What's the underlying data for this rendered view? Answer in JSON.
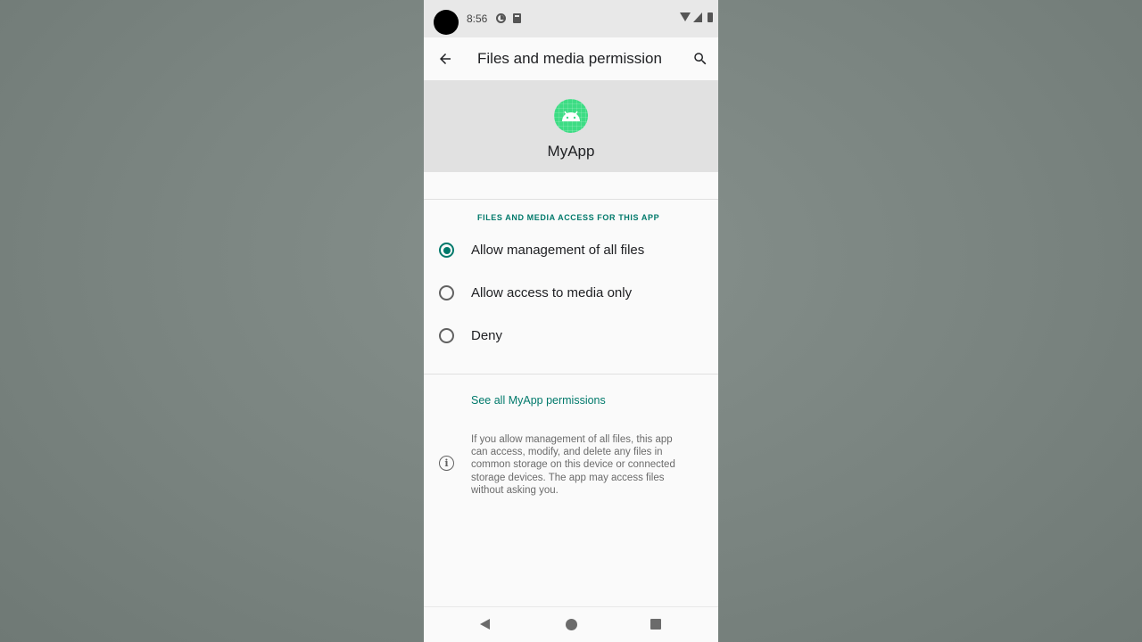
{
  "status_bar": {
    "time": "8:56"
  },
  "app_bar": {
    "title": "Files and media permission"
  },
  "app": {
    "name": "MyApp"
  },
  "section": {
    "header": "FILES AND MEDIA ACCESS FOR THIS APP"
  },
  "options": [
    {
      "label": "Allow management of all files",
      "selected": true
    },
    {
      "label": "Allow access to media only",
      "selected": false
    },
    {
      "label": "Deny",
      "selected": false
    }
  ],
  "link": {
    "label": "See all MyApp permissions"
  },
  "info": {
    "text": "If you allow management of all files, this app can access, modify, and delete any files in common storage on this device or connected storage devices. The app may access files without asking you."
  },
  "colors": {
    "accent": "#00796b",
    "app_icon": "#3ddc84",
    "header_bg": "#e1e1e1"
  },
  "icons": {
    "back": "arrow-left-icon",
    "search": "search-icon",
    "app": "android-icon",
    "info": "info-icon"
  }
}
